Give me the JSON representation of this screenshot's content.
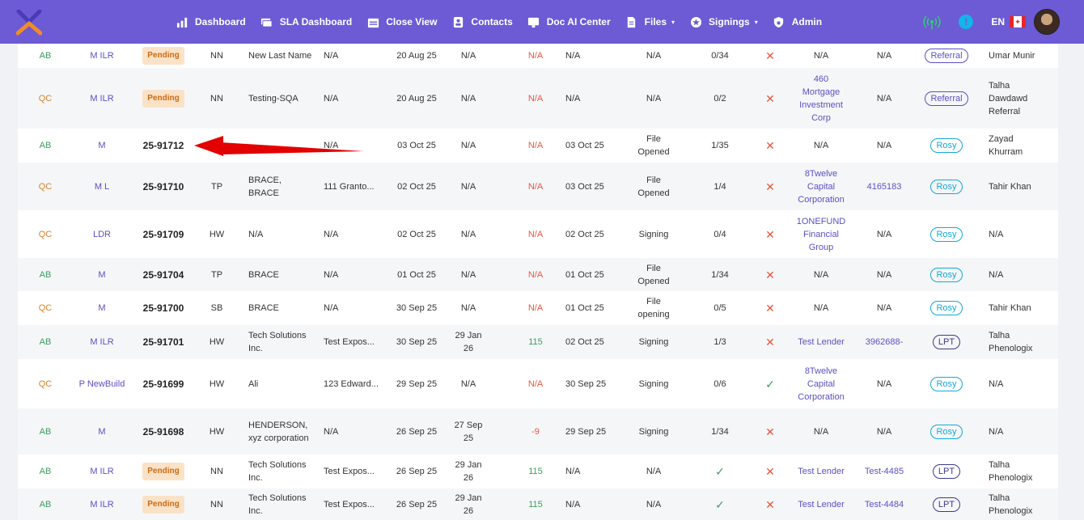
{
  "nav": {
    "items": [
      {
        "label": "Dashboard",
        "icon": "chart-icon",
        "caret": false
      },
      {
        "label": "SLA Dashboard",
        "icon": "cash-icon",
        "caret": false
      },
      {
        "label": "Close View",
        "icon": "calendar-icon",
        "caret": false
      },
      {
        "label": "Contacts",
        "icon": "contact-icon",
        "caret": false
      },
      {
        "label": "Doc AI Center",
        "icon": "doc-ai-icon",
        "caret": false
      },
      {
        "label": "Files",
        "icon": "file-icon",
        "caret": true
      },
      {
        "label": "Signings",
        "icon": "badge-icon",
        "caret": true
      },
      {
        "label": "Admin",
        "icon": "lock-icon",
        "caret": false
      }
    ],
    "info_icon": "!",
    "language": "EN",
    "flag_glyph": "✦",
    "colors": {
      "bar": "#6c5bd4",
      "signal": "#2ecc71",
      "info": "#13b5ea"
    }
  },
  "rows": [
    {
      "prov": "AB",
      "type": "M ILR",
      "file": "Pending",
      "pending": true,
      "agent": "NN",
      "borrower": "New Last Name",
      "address": "N/A",
      "created": "20 Aug 25",
      "closing": "N/A",
      "days": "N/A",
      "days_color": "red",
      "funded": "N/A",
      "status": "N/A",
      "docs": "0/34",
      "flag": "x",
      "lender": "N/A",
      "lender_color": "plain",
      "ref": "N/A",
      "ref_color": "plain",
      "source": "Referral",
      "source_kind": "referral",
      "rep": "Umar Munir"
    },
    {
      "prov": "QC",
      "type": "M ILR",
      "file": "Pending",
      "pending": true,
      "agent": "NN",
      "borrower": "Testing-SQA",
      "address": "N/A",
      "created": "20 Aug 25",
      "closing": "N/A",
      "days": "N/A",
      "days_color": "red",
      "funded": "N/A",
      "status": "N/A",
      "docs": "0/2",
      "flag": "x",
      "lender": "460 Mortgage Investment Corp",
      "lender_color": "purple",
      "ref": "N/A",
      "ref_color": "plain",
      "source": "Referral",
      "source_kind": "referral",
      "rep": "Talha Dawdawd Referral"
    },
    {
      "prov": "AB",
      "type": "M",
      "file": "25-91712",
      "pending": false,
      "agent": "",
      "borrower": "",
      "address": "N/A",
      "created": "03 Oct 25",
      "closing": "N/A",
      "days": "N/A",
      "days_color": "red",
      "funded": "03 Oct 25",
      "status": "File Opened",
      "docs": "1/35",
      "flag": "x",
      "lender": "N/A",
      "lender_color": "plain",
      "ref": "N/A",
      "ref_color": "plain",
      "source": "Rosy",
      "source_kind": "rosy",
      "rep": "Zayad Khurram"
    },
    {
      "prov": "QC",
      "type": "M L",
      "file": "25-91710",
      "pending": false,
      "agent": "TP",
      "borrower": "BRACE, BRACE",
      "address": "111 Granto...",
      "created": "02 Oct 25",
      "closing": "N/A",
      "days": "N/A",
      "days_color": "red",
      "funded": "03 Oct 25",
      "status": "File Opened",
      "docs": "1/4",
      "flag": "x",
      "lender": "8Twelve Capital Corporation",
      "lender_color": "purple",
      "ref": "4165183",
      "ref_color": "purple",
      "source": "Rosy",
      "source_kind": "rosy",
      "rep": "Tahir Khan"
    },
    {
      "prov": "QC",
      "type": "LDR",
      "file": "25-91709",
      "pending": false,
      "agent": "HW",
      "borrower": "N/A",
      "address": "N/A",
      "created": "02 Oct 25",
      "closing": "N/A",
      "days": "N/A",
      "days_color": "red",
      "funded": "02 Oct 25",
      "status": "Signing",
      "docs": "0/4",
      "flag": "x",
      "lender": "1ONEFUND Financial Group",
      "lender_color": "purple",
      "ref": "N/A",
      "ref_color": "plain",
      "source": "Rosy",
      "source_kind": "rosy",
      "rep": "N/A"
    },
    {
      "prov": "AB",
      "type": "M",
      "file": "25-91704",
      "pending": false,
      "agent": "TP",
      "borrower": "BRACE",
      "address": "N/A",
      "created": "01 Oct 25",
      "closing": "N/A",
      "days": "N/A",
      "days_color": "red",
      "funded": "01 Oct 25",
      "status": "File Opened",
      "docs": "1/34",
      "flag": "x",
      "lender": "N/A",
      "lender_color": "plain",
      "ref": "N/A",
      "ref_color": "plain",
      "source": "Rosy",
      "source_kind": "rosy",
      "rep": "N/A"
    },
    {
      "prov": "QC",
      "type": "M",
      "file": "25-91700",
      "pending": false,
      "agent": "SB",
      "borrower": "BRACE",
      "address": "N/A",
      "created": "30 Sep 25",
      "closing": "N/A",
      "days": "N/A",
      "days_color": "red",
      "funded": "01 Oct 25",
      "status": "File opening",
      "docs": "0/5",
      "flag": "x",
      "lender": "N/A",
      "lender_color": "plain",
      "ref": "N/A",
      "ref_color": "plain",
      "source": "Rosy",
      "source_kind": "rosy",
      "rep": "Tahir Khan"
    },
    {
      "prov": "AB",
      "type": "M ILR",
      "file": "25-91701",
      "pending": false,
      "agent": "HW",
      "borrower": "Tech Solutions Inc.",
      "address": "Test Expos...",
      "created": "30 Sep 25",
      "closing": "29 Jan 26",
      "days": "115",
      "days_color": "green",
      "funded": "02 Oct 25",
      "status": "Signing",
      "docs": "1/3",
      "flag": "x",
      "lender": "Test Lender",
      "lender_color": "purple",
      "ref": "3962688-",
      "ref_color": "purple",
      "source": "LPT",
      "source_kind": "lpt",
      "rep": "Talha Phenologix"
    },
    {
      "prov": "QC",
      "type": "P NewBuild",
      "file": "25-91699",
      "pending": false,
      "agent": "HW",
      "borrower": "Ali",
      "address": "123 Edward...",
      "created": "29 Sep 25",
      "closing": "N/A",
      "days": "N/A",
      "days_color": "red",
      "funded": "30 Sep 25",
      "status": "Signing",
      "docs": "0/6",
      "flag": "check",
      "lender": "8Twelve Capital Corporation",
      "lender_color": "purple",
      "ref": "N/A",
      "ref_color": "plain",
      "source": "Rosy",
      "source_kind": "rosy",
      "rep": "N/A"
    },
    {
      "prov": "AB",
      "type": "M",
      "file": "25-91698",
      "pending": false,
      "agent": "HW",
      "borrower": "HENDERSON, xyz corporation",
      "address": "N/A",
      "created": "26 Sep 25",
      "closing": "27 Sep 25",
      "days": "-9",
      "days_color": "red",
      "funded": "29 Sep 25",
      "status": "Signing",
      "docs": "1/34",
      "flag": "x",
      "lender": "N/A",
      "lender_color": "plain",
      "ref": "N/A",
      "ref_color": "plain",
      "source": "Rosy",
      "source_kind": "rosy",
      "rep": "N/A"
    },
    {
      "prov": "AB",
      "type": "M ILR",
      "file": "Pending",
      "pending": true,
      "agent": "NN",
      "borrower": "Tech Solutions Inc.",
      "address": "Test Expos...",
      "created": "26 Sep 25",
      "closing": "29 Jan 26",
      "days": "115",
      "days_color": "green",
      "funded": "N/A",
      "status": "N/A",
      "docs": "check",
      "flag": "x",
      "lender": "Test Lender",
      "lender_color": "purple",
      "ref": "Test-4485",
      "ref_color": "purple",
      "source": "LPT",
      "source_kind": "lpt",
      "rep": "Talha Phenologix"
    },
    {
      "prov": "AB",
      "type": "M ILR",
      "file": "Pending",
      "pending": true,
      "agent": "NN",
      "borrower": "Tech Solutions Inc.",
      "address": "Test Expos...",
      "created": "26 Sep 25",
      "closing": "29 Jan 26",
      "days": "115",
      "days_color": "green",
      "funded": "N/A",
      "status": "N/A",
      "docs": "check",
      "flag": "x",
      "lender": "Test Lender",
      "lender_color": "purple",
      "ref": "Test-4484",
      "ref_color": "purple",
      "source": "LPT",
      "source_kind": "lpt",
      "rep": "Talha Phenologix"
    }
  ]
}
